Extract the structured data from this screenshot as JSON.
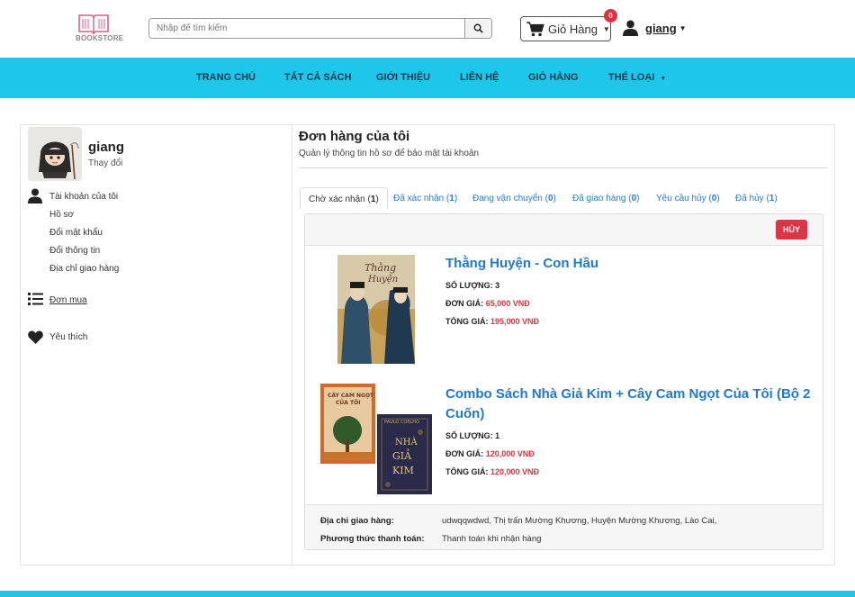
{
  "header": {
    "logo_text": "BOOKSTORE",
    "search_placeholder": "Nhập để tìm kiếm",
    "cart_label": "Giỏ Hàng",
    "cart_count": "0",
    "username": "giang"
  },
  "nav": {
    "items": [
      "TRANG CHỦ",
      "TẤT CẢ SÁCH",
      "GIỚI THIỆU",
      "LIÊN HỆ",
      "GIỎ HÀNG",
      "THỂ LOẠI"
    ]
  },
  "sidebar": {
    "name": "giang",
    "change": "Thay đổi",
    "account": "Tài khoản của tôi",
    "sub_items": [
      "Hồ sơ",
      "Đổi mật khẩu",
      "Đổi thông tin",
      "Địa chỉ giao hàng"
    ],
    "orders": "Đơn mua",
    "favorites": "Yêu thích"
  },
  "content": {
    "title": "Đơn hàng của tôi",
    "subtitle": "Quản lý thông tin hồ sơ để bảo mật tài khoản",
    "tabs": [
      {
        "label": "Chờ xác nhận",
        "count": "1"
      },
      {
        "label": "Đã xác nhận",
        "count": "1"
      },
      {
        "label": "Đang vận chuyển",
        "count": "0"
      },
      {
        "label": "Đã giao hàng",
        "count": "0"
      },
      {
        "label": "Yêu cầu hủy",
        "count": "0"
      },
      {
        "label": "Đã hủy",
        "count": "1"
      }
    ],
    "cancel_label": "HỦY",
    "labels": {
      "quantity": "SỐ LƯỢNG:",
      "unit_price": "ĐƠN GIÁ:",
      "total": "TỔNG GIÁ:"
    },
    "products": [
      {
        "title": "Thằng Huyện - Con Hầu",
        "quantity": "3",
        "unit_price": "65,000 VNĐ",
        "total": "195,000 VNĐ"
      },
      {
        "title": "Combo Sách Nhà Giả Kim + Cây Cam Ngọt Của Tôi (Bộ 2 Cuốn)",
        "quantity": "1",
        "unit_price": "120,000 VNĐ",
        "total": "120,000 VNĐ"
      }
    ],
    "address_label": "Địa chỉ giao hàng:",
    "address_value": "udwqqwdwd, Thị trấn Mường Khương, Huyện Mường Khương, Lào Cai,",
    "payment_label": "Phương thức thanh toán:",
    "payment_value": "Thanh toán khi nhận hàng"
  },
  "colors": {
    "nav_bg": "#1ec6ea",
    "link": "#1e78d6",
    "danger": "#dc3545"
  }
}
